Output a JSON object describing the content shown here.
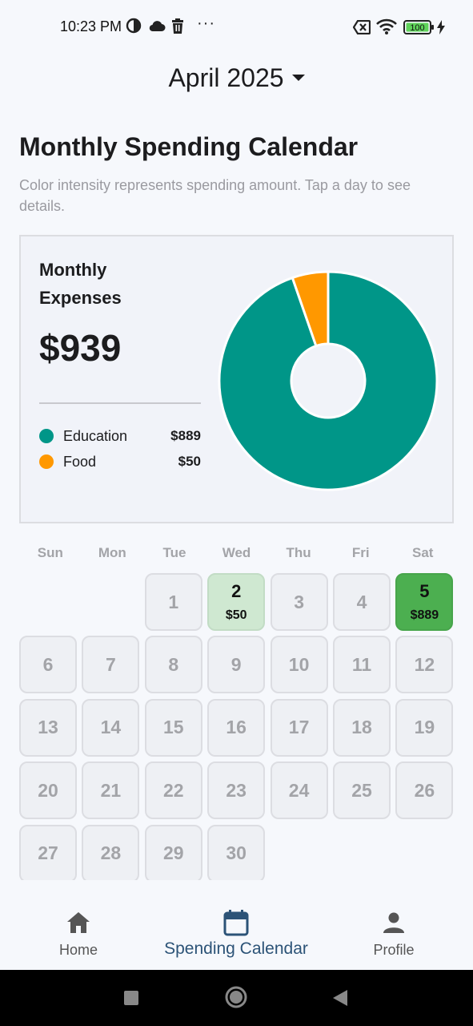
{
  "status_bar": {
    "time": "10:23 PM",
    "dots": "···",
    "battery_level": "100",
    "icons": [
      "sync-icon",
      "cloud-icon",
      "trash-icon",
      "overflow-dots-icon",
      "sim-off-icon",
      "wifi-icon",
      "battery-icon",
      "charging-icon"
    ]
  },
  "header": {
    "month_label": "April 2025"
  },
  "page": {
    "title": "Monthly Spending Calendar",
    "subtitle": "Color intensity represents spending amount. Tap a day to see details."
  },
  "expense_card": {
    "title": "Monthly Expenses",
    "total": "$939",
    "legend": [
      {
        "label": "Education",
        "value": "$889",
        "color": "#009688"
      },
      {
        "label": "Food",
        "value": "$50",
        "color": "#ff9800"
      }
    ]
  },
  "chart_data": {
    "type": "pie",
    "categories": [
      "Education",
      "Food"
    ],
    "values": [
      889,
      50
    ],
    "colors": [
      "#009688",
      "#ff9800"
    ]
  },
  "calendar": {
    "weekdays": [
      "Sun",
      "Mon",
      "Tue",
      "Wed",
      "Thu",
      "Fri",
      "Sat"
    ],
    "first_weekday_index": 2,
    "days": [
      {
        "day": "1"
      },
      {
        "day": "2",
        "amount": "$50",
        "level": "low"
      },
      {
        "day": "3"
      },
      {
        "day": "4"
      },
      {
        "day": "5",
        "amount": "$889",
        "level": "high"
      },
      {
        "day": "6"
      },
      {
        "day": "7"
      },
      {
        "day": "8"
      },
      {
        "day": "9"
      },
      {
        "day": "10"
      },
      {
        "day": "11"
      },
      {
        "day": "12"
      },
      {
        "day": "13"
      },
      {
        "day": "14"
      },
      {
        "day": "15"
      },
      {
        "day": "16"
      },
      {
        "day": "17"
      },
      {
        "day": "18"
      },
      {
        "day": "19"
      },
      {
        "day": "20"
      },
      {
        "day": "21"
      },
      {
        "day": "22"
      },
      {
        "day": "23"
      },
      {
        "day": "24"
      },
      {
        "day": "25"
      },
      {
        "day": "26"
      },
      {
        "day": "27"
      },
      {
        "day": "28"
      },
      {
        "day": "29"
      },
      {
        "day": "30"
      }
    ],
    "colors": {
      "low": "#cfe8d1",
      "high": "#4caf50",
      "empty": "#eef0f4"
    }
  },
  "bottom_nav": {
    "items": [
      {
        "label": "Home",
        "icon": "home-icon"
      },
      {
        "label": "Spending Calendar",
        "icon": "calendar-icon",
        "active": true
      },
      {
        "label": "Profile",
        "icon": "person-icon"
      }
    ],
    "accent": "#2c5377"
  },
  "system_nav": {
    "icons": [
      "recents-icon",
      "home-circle-icon",
      "back-icon"
    ]
  }
}
